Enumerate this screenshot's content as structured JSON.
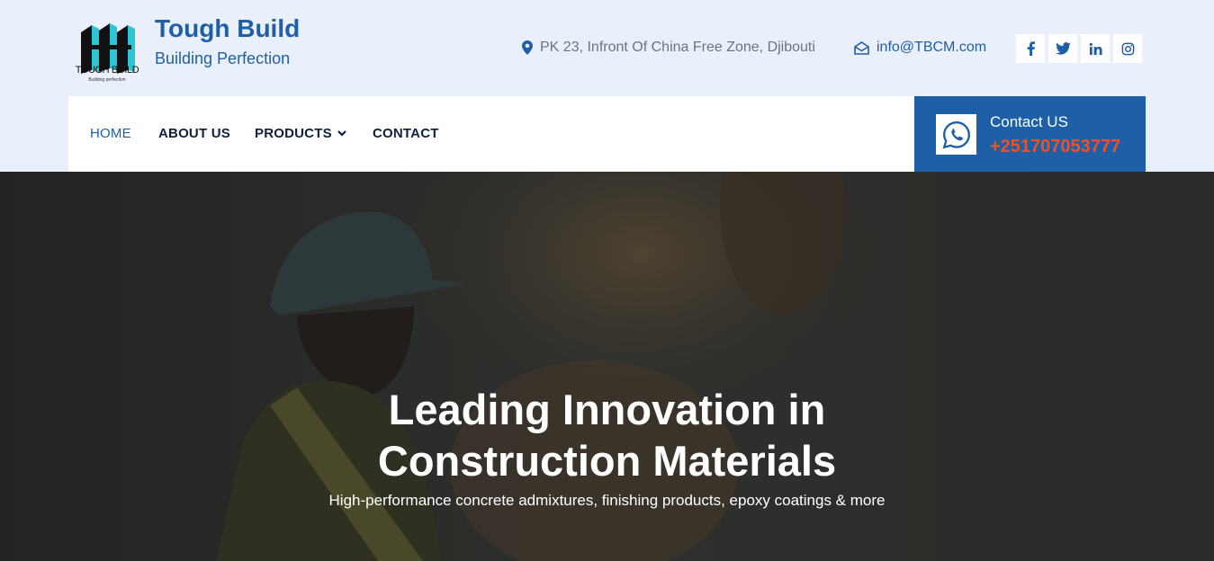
{
  "brand": {
    "title": "Tough Build",
    "tagline": "Building Perfection",
    "logo_text": "TOUGH BUILD",
    "logo_subtext": "Building perfection"
  },
  "topbar": {
    "address": "PK 23, Infront Of China Free Zone, Djibouti",
    "email": "info@TBCM.com",
    "socials": [
      {
        "name": "facebook",
        "glyph": "f"
      },
      {
        "name": "twitter",
        "glyph": "t"
      },
      {
        "name": "linkedin",
        "glyph": "in"
      },
      {
        "name": "instagram",
        "glyph": "ig"
      }
    ]
  },
  "nav": {
    "home": "HOME",
    "about": "ABOUT US",
    "products": "PRODUCTS",
    "contact": "CONTACT"
  },
  "contact_box": {
    "label": "Contact US",
    "phone": "+251707053777"
  },
  "hero": {
    "title_line1": "Leading Innovation in",
    "title_line2": "Construction Materials",
    "subtitle": "High-performance concrete admixtures, finishing products, epoxy coatings & more"
  },
  "colors": {
    "brand_blue": "#1f5fa8",
    "accent_orange": "#e8542a",
    "topbar_bg": "#eaf0fb",
    "nav_text": "#0f1f3d"
  }
}
